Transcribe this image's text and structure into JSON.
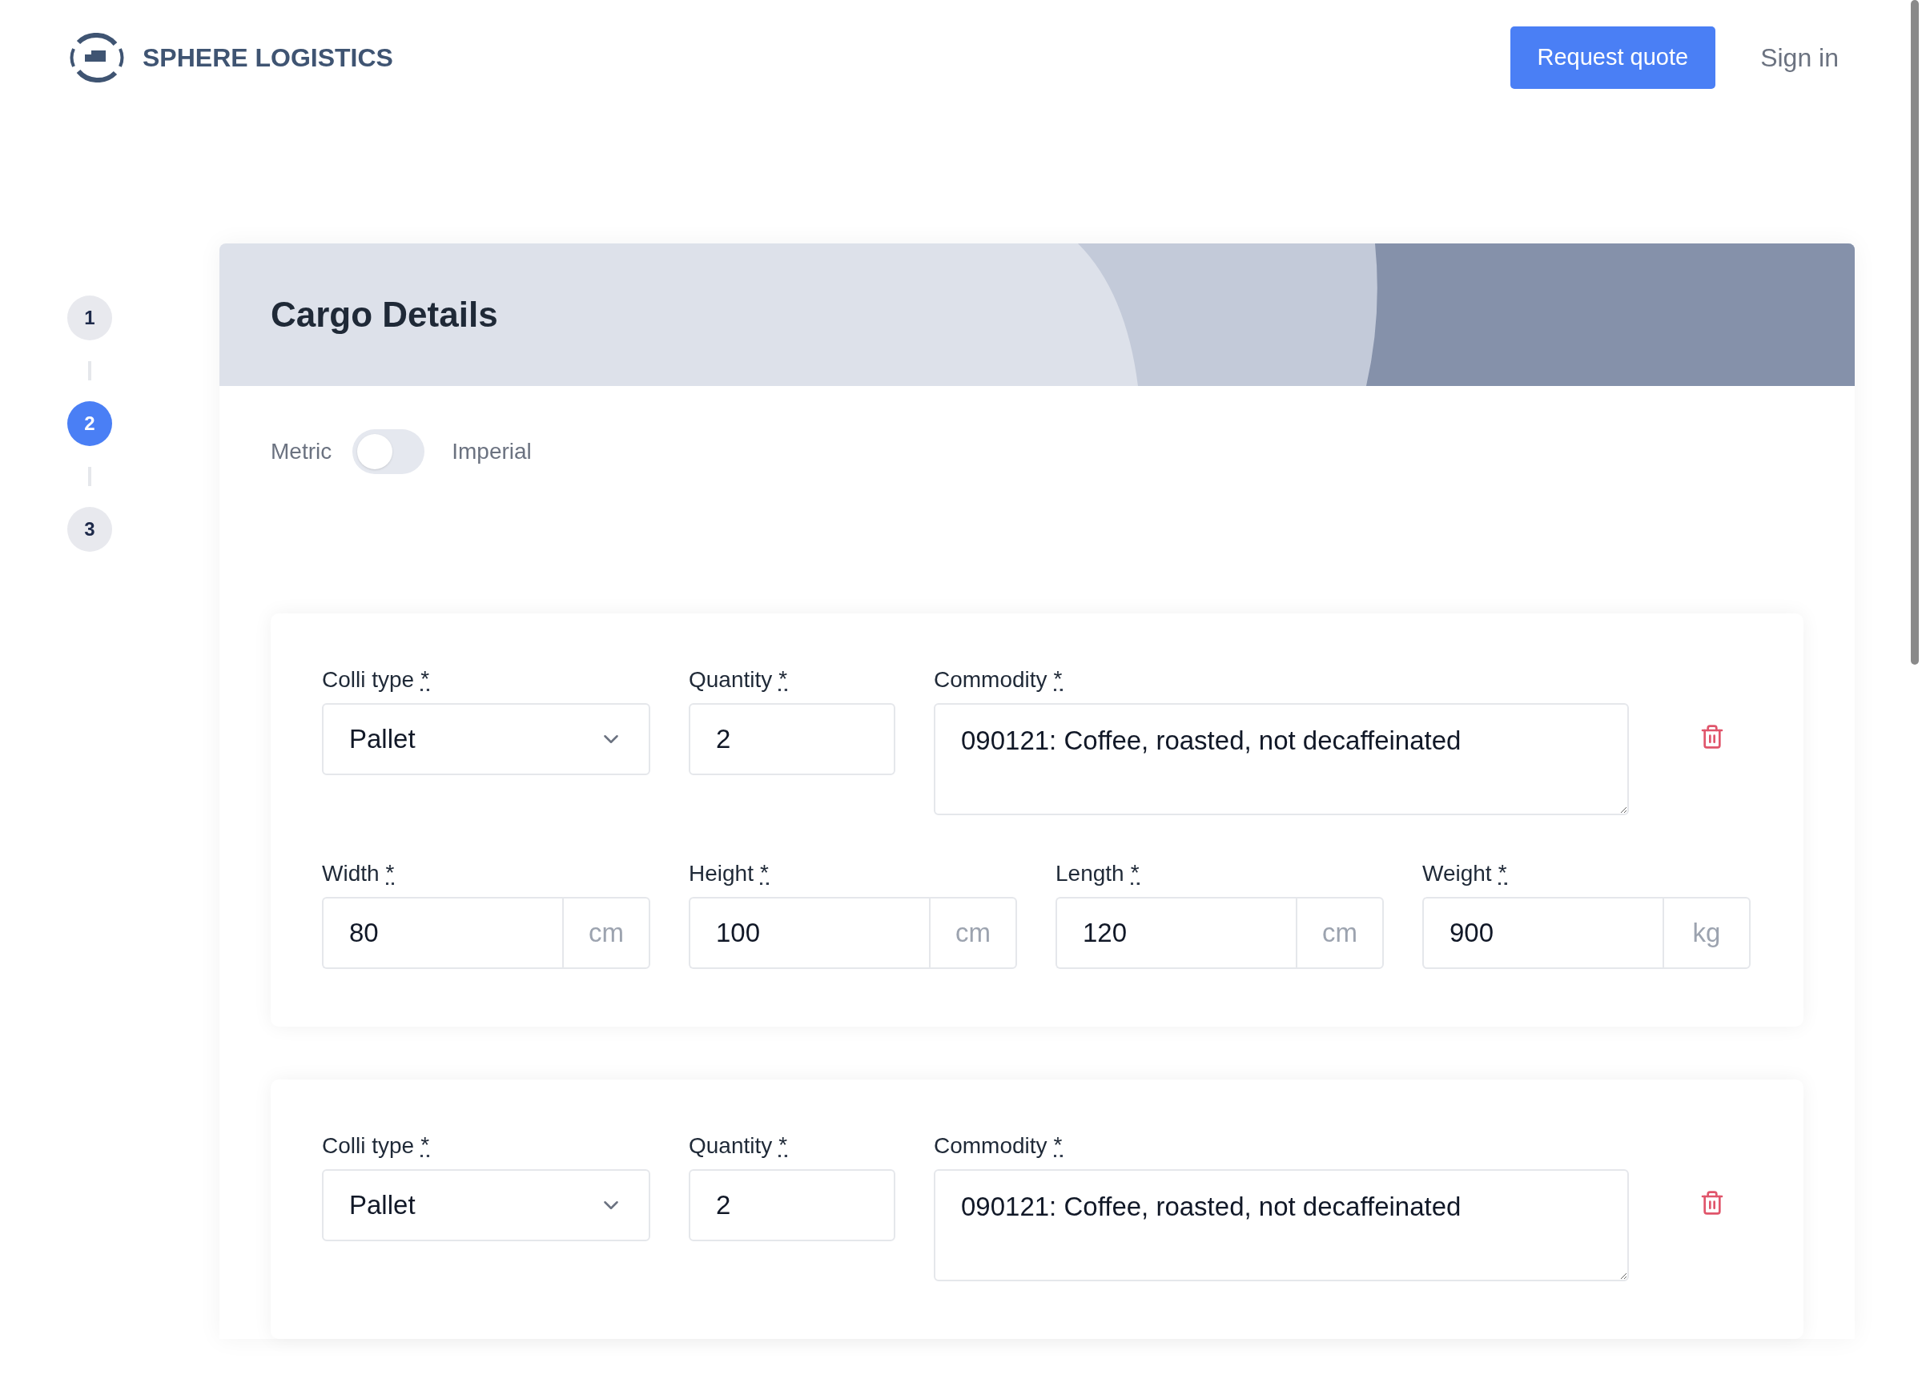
{
  "header": {
    "logo_text": "SPHERE LOGISTICS",
    "request_button": "Request quote",
    "sign_in": "Sign in"
  },
  "steps": [
    {
      "label": "1",
      "selected": false
    },
    {
      "label": "2",
      "selected": true
    },
    {
      "label": "3",
      "selected": false
    }
  ],
  "title": "Cargo Details",
  "unit_toggle": {
    "left_label": "Metric",
    "right_label": "Imperial",
    "on": false
  },
  "cargo_items": [
    {
      "rows": [
        [
          {
            "kind": "select",
            "label": "Colli type",
            "required_mark": "*",
            "value": "Pallet"
          },
          {
            "kind": "number",
            "label": "Quantity",
            "required_mark": "*",
            "value": "2"
          },
          {
            "kind": "textarea",
            "label": "Commodity",
            "required_mark": "*",
            "value": "090121: Coffee, roasted, not decaffeinated"
          }
        ],
        [
          {
            "kind": "unit",
            "label": "Width",
            "required_mark": "*",
            "value": "80",
            "unit": "cm"
          },
          {
            "kind": "unit",
            "label": "Height",
            "required_mark": "*",
            "value": "100",
            "unit": "cm"
          },
          {
            "kind": "unit",
            "label": "Length",
            "required_mark": "*",
            "value": "120",
            "unit": "cm"
          },
          {
            "kind": "unit",
            "label": "Weight",
            "required_mark": "*",
            "value": "900",
            "unit": "kg"
          }
        ]
      ]
    },
    {
      "rows": [
        [
          {
            "kind": "select",
            "label": "Colli type",
            "required_mark": "*",
            "value": "Pallet"
          },
          {
            "kind": "number",
            "label": "Quantity",
            "required_mark": "*",
            "value": "2"
          },
          {
            "kind": "textarea",
            "label": "Commodity",
            "required_mark": "*",
            "value": "090121: Coffee, roasted, not decaffeinated"
          }
        ]
      ]
    }
  ]
}
